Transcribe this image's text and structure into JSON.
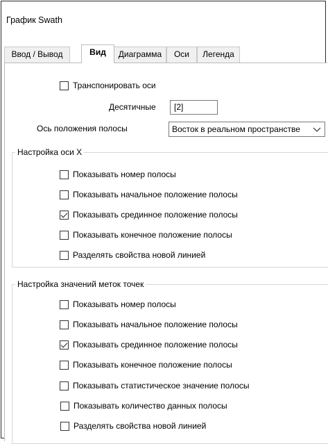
{
  "window": {
    "title": "График Swath"
  },
  "tabs": [
    {
      "label": "Ввод / Вывод",
      "active": false
    },
    {
      "label": "Вид",
      "active": true
    },
    {
      "label": "Диаграмма",
      "active": false
    },
    {
      "label": "Оси",
      "active": false
    },
    {
      "label": "Легенда",
      "active": false
    }
  ],
  "view": {
    "transpose_axes": {
      "label": "Транспонировать оси",
      "checked": false
    },
    "decimals": {
      "label": "Десятичные",
      "value": "[2]"
    },
    "strip_axis": {
      "label": "Ось положения полосы",
      "value": "Восток в реальном пространстве"
    }
  },
  "x_axis_group": {
    "title": "Настройка оси X",
    "options": [
      {
        "label": "Показывать номер полосы",
        "checked": false
      },
      {
        "label": "Показывать начальное положение полосы",
        "checked": false
      },
      {
        "label": "Показывать срединное положение полосы",
        "checked": true
      },
      {
        "label": "Показывать конечное положение полосы",
        "checked": false
      },
      {
        "label": "Разделять свойства новой линией",
        "checked": false
      }
    ]
  },
  "point_labels_group": {
    "title": "Настройка значений меток точек",
    "options": [
      {
        "label": "Показывать номер полосы",
        "checked": false
      },
      {
        "label": "Показывать начальное положение полосы",
        "checked": false
      },
      {
        "label": "Показывать срединное положение полосы",
        "checked": true
      },
      {
        "label": "Показывать конечное положение полосы",
        "checked": false
      },
      {
        "label": "Показывать статистическое значение полосы",
        "checked": false
      },
      {
        "label": "Показывать количество данных полосы",
        "checked": false
      },
      {
        "label": "Разделять свойства новой линией",
        "checked": false
      }
    ]
  },
  "icons": {
    "dropdown": "chevron-down-icon"
  }
}
